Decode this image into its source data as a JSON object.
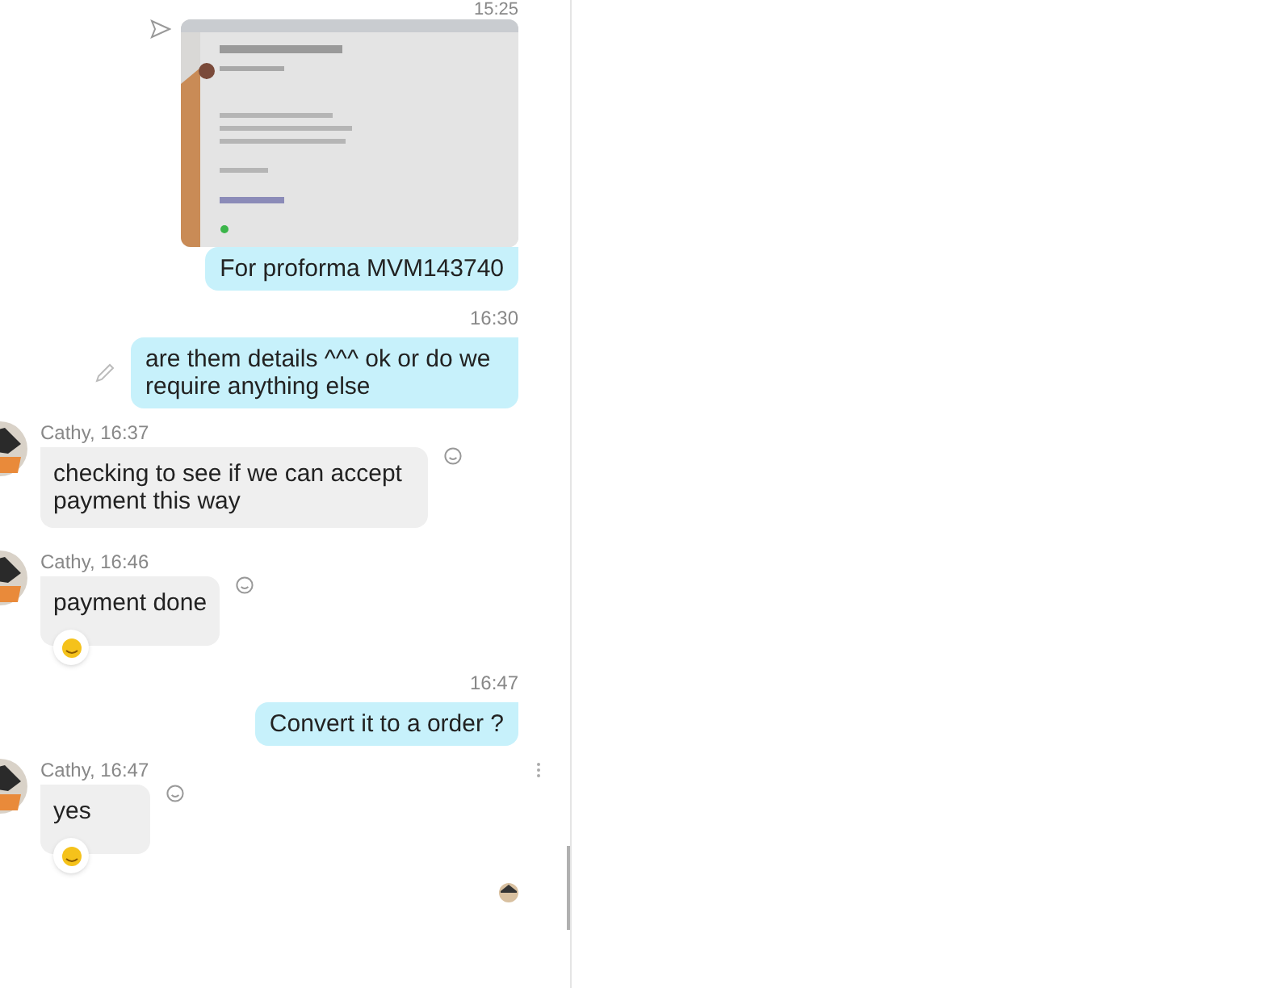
{
  "top_time": "15:25",
  "messages": [
    {
      "kind": "outgoing",
      "sent_icon": true,
      "text": "For proforma MVM143740"
    },
    {
      "kind": "outgoing",
      "time": "16:30",
      "edited": true,
      "text": "are them details ^^^ ok or do we require anything else"
    },
    {
      "kind": "incoming",
      "time": "Cathy, 16:37",
      "text": "checking to see if we can accept payment this way",
      "reaction": false
    },
    {
      "kind": "incoming",
      "time": "Cathy, 16:46",
      "text": "payment done",
      "reaction": true
    },
    {
      "kind": "outgoing",
      "time": "16:47",
      "edited": false,
      "text": "Convert it to a order ?"
    },
    {
      "kind": "incoming",
      "time": "Cathy, 16:47",
      "text": "yes",
      "reaction": true,
      "more": true
    }
  ],
  "read_receipt": true
}
